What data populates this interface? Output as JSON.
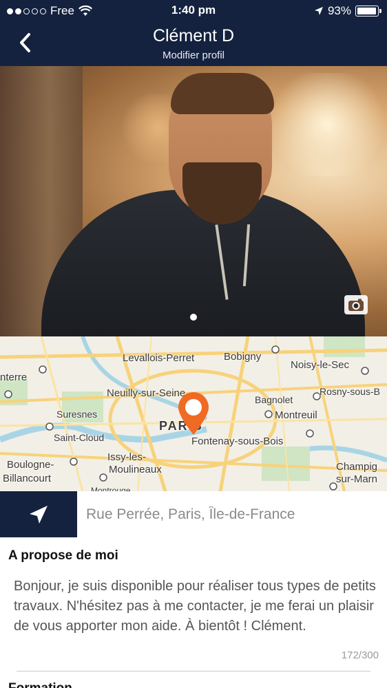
{
  "status_bar": {
    "carrier": "Free",
    "time": "1:40 pm",
    "battery": "93%",
    "signal_icon": "signal-dots-icon",
    "wifi_icon": "wifi-icon",
    "location_icon": "location-arrow-icon",
    "battery_icon": "battery-icon"
  },
  "header": {
    "title": "Clément D",
    "subtitle": "Modifier profil",
    "back_icon": "chevron-left-icon",
    "background": "#14223f"
  },
  "photo": {
    "pager_dots": 1,
    "camera_icon": "camera-icon"
  },
  "map": {
    "labels": [
      "Levallois-Perret",
      "Bobigny",
      "Noisy-le-Sec",
      "nterre",
      "Neuilly-sur-Seine",
      "Bagnolet",
      "Rosny-sous-B",
      "Suresnes",
      "PARIS",
      "Montreuil",
      "Saint-Cloud",
      "Fontenay-sous-Bois",
      "Boulogne-",
      "Issy-les-",
      "Champig",
      "Billancourt",
      "Moulineaux",
      "sur-Marn",
      "Montrouge"
    ],
    "pin_color": "#f06a24",
    "pin_icon": "map-pin-icon"
  },
  "address": {
    "value": "Rue Perrée, Paris, Île-de-France",
    "locate_icon": "navigation-arrow-icon"
  },
  "about": {
    "title": "A propose de moi",
    "text": "Bonjour, je suis disponible pour réaliser tous types de petits travaux. N'hésitez pas à me contacter, je me ferai un plaisir de vous apporter mon aide. À bientôt ! Clément.",
    "counter": "172/300"
  },
  "formation": {
    "title": "Formation"
  }
}
